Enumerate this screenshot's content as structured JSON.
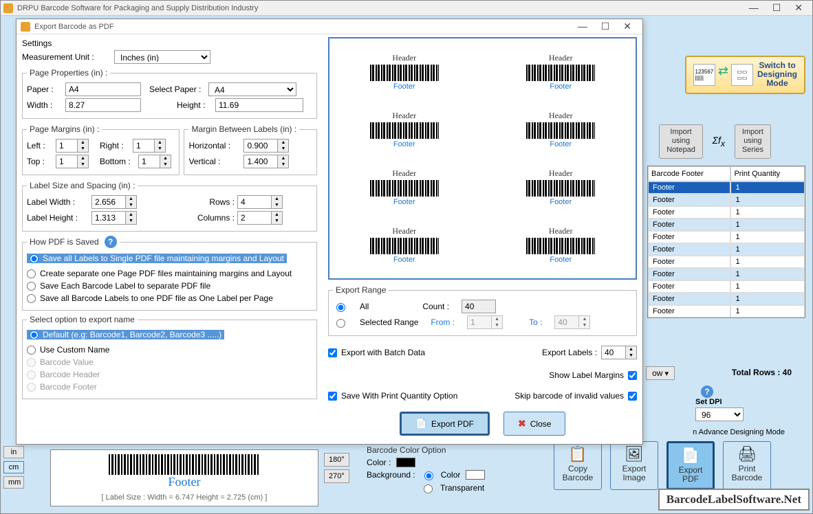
{
  "main_title": "DRPU Barcode Software for Packaging and Supply Distribution Industry",
  "dialog_title": "Export Barcode as PDF",
  "settings": {
    "legend": "Settings",
    "unit_label": "Measurement Unit :",
    "unit_value": "Inches (in)"
  },
  "page_props": {
    "legend": "Page Properties (in) :",
    "paper_label": "Paper :",
    "paper_value": "A4",
    "select_paper_label": "Select Paper :",
    "select_paper_value": "A4",
    "width_label": "Width :",
    "width_value": "8.27",
    "height_label": "Height :",
    "height_value": "11.69"
  },
  "margins": {
    "legend": "Page Margins (in) :",
    "left_label": "Left :",
    "left_value": "1",
    "right_label": "Right :",
    "right_value": "1",
    "top_label": "Top :",
    "top_value": "1",
    "bottom_label": "Bottom :",
    "bottom_value": "1"
  },
  "between": {
    "legend": "Margin Between Labels (in) :",
    "h_label": "Horizontal :",
    "h_value": "0.900",
    "v_label": "Vertical :",
    "v_value": "1.400"
  },
  "size": {
    "legend": "Label Size and Spacing (in) :",
    "lw_label": "Label Width :",
    "lw_value": "2.656",
    "lh_label": "Label Height :",
    "lh_value": "1.313",
    "rows_label": "Rows :",
    "rows_value": "4",
    "cols_label": "Columns :",
    "cols_value": "2"
  },
  "how_saved": {
    "legend": "How PDF is Saved",
    "opt1": "Save all Labels to Single PDF file maintaining margins and Layout",
    "opt2": "Create separate one Page PDF files maintaining margins and Layout",
    "opt3": "Save Each Barcode Label to separate PDF file",
    "opt4": "Save all Barcode Labels to one PDF file as One Label per Page"
  },
  "export_name": {
    "legend": "Select option to export name",
    "opt1": "Default (e.g: Barcode1, Barcode2, Barcode3  .....)",
    "opt2": "Use Custom Name",
    "opt3": "Barcode Value",
    "opt4": "Barcode Header",
    "opt5": "Barcode Footer"
  },
  "preview": {
    "header": "Header",
    "footer": "Footer"
  },
  "export_range": {
    "legend": "Export Range",
    "all": "All",
    "selected": "Selected Range",
    "count_label": "Count :",
    "count_value": "40",
    "from_label": "From :",
    "from_value": "1",
    "to_label": "To :",
    "to_value": "40"
  },
  "checks": {
    "batch": "Export with Batch Data",
    "save_qty": "Save With Print Quantity Option",
    "show_margins": "Show Label Margins",
    "skip_invalid": "Skip barcode of invalid values",
    "export_labels_label": "Export Labels :",
    "export_labels_value": "40"
  },
  "buttons": {
    "export": "Export PDF",
    "close": "Close"
  },
  "bg": {
    "switch_mode": "Switch to\nDesigning\nMode",
    "import_notepad": "Import\nusing\nNotepad",
    "import_series": "Import\nusing\nSeries",
    "table_hdr1": "Barcode Footer",
    "table_hdr2": "Print Quantity",
    "footer_cell": "Footer",
    "qty_cell": "1",
    "total_rows": "Total Rows : 40",
    "ow": "ow",
    "set_dpi": "Set DPI",
    "dpi_value": "96",
    "adv": "n Advance Designing Mode",
    "copy": "Copy Barcode",
    "exp_img": "Export Image",
    "exp_pdf": "Export PDF",
    "print": "Print Barcode",
    "color_legend": "Barcode Color Option",
    "color_label": "Color :",
    "bg_label": "Background :",
    "bg_color": "Color",
    "bg_trans": "Transparent",
    "rot1": "180°",
    "rot2": "270°",
    "label_size": "[ Label Size : Width = 6.747  Height = 2.725 (cm) ]",
    "preview_footer": "Footer",
    "watermark": "BarcodeLabelSoftware.Net",
    "unit_in": "in",
    "unit_cm": "cm",
    "unit_mm": "mm"
  }
}
